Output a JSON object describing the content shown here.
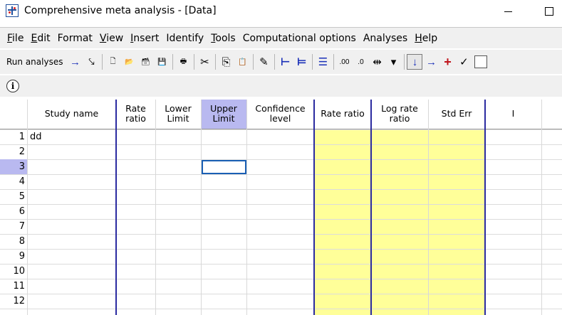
{
  "window": {
    "title": "Comprehensive meta analysis - [Data]"
  },
  "menu": [
    {
      "label": "File",
      "ul": "F",
      "rest": "ile"
    },
    {
      "label": "Edit",
      "ul": "E",
      "rest": "dit"
    },
    {
      "label": "Format",
      "ul": "",
      "rest": "Format"
    },
    {
      "label": "View",
      "ul": "V",
      "rest": "iew"
    },
    {
      "label": "Insert",
      "ul": "I",
      "rest": "nsert"
    },
    {
      "label": "Identify",
      "ul": "",
      "rest": "Identify"
    },
    {
      "label": "Tools",
      "ul": "T",
      "rest": "ools"
    },
    {
      "label": "Computational options",
      "ul": "",
      "rest": "Computational options"
    },
    {
      "label": "Analyses",
      "ul": "",
      "rest": "Analyses"
    },
    {
      "label": "Help",
      "ul": "H",
      "rest": "elp"
    }
  ],
  "toolbar": {
    "run_label": "Run analyses",
    "icons": [
      {
        "name": "run-arrow-icon",
        "glyph": "→"
      },
      {
        "name": "wand-icon",
        "glyph": "⤥"
      },
      {
        "name": "new-file-icon",
        "glyph": "🗋"
      },
      {
        "name": "open-folder-icon",
        "glyph": "📂"
      },
      {
        "name": "save-all-icon",
        "glyph": "🗃"
      },
      {
        "name": "save-icon",
        "glyph": "💾"
      },
      {
        "name": "print-icon",
        "glyph": "🖶"
      },
      {
        "name": "cut-icon",
        "glyph": "✂"
      },
      {
        "name": "copy-icon",
        "glyph": "⎘"
      },
      {
        "name": "paste-icon",
        "glyph": "📋"
      },
      {
        "name": "edit-icon",
        "glyph": "✎"
      },
      {
        "name": "decrease-indent-icon",
        "glyph": "⊢"
      },
      {
        "name": "increase-indent-icon",
        "glyph": "⊨"
      },
      {
        "name": "list-indent-icon",
        "glyph": "☰"
      },
      {
        "name": "increase-decimals-icon",
        "glyph": ".00"
      },
      {
        "name": "decrease-decimals-icon",
        "glyph": ".0"
      },
      {
        "name": "column-width-icon",
        "glyph": "⇹"
      },
      {
        "name": "dropdown-icon",
        "glyph": "▾"
      },
      {
        "name": "move-down-icon",
        "glyph": "↓"
      },
      {
        "name": "move-right-icon",
        "glyph": "→"
      },
      {
        "name": "plus-icon",
        "glyph": "+"
      },
      {
        "name": "check-icon",
        "glyph": "✓"
      }
    ]
  },
  "grid": {
    "headers": [
      {
        "label": "Study name"
      },
      {
        "label": "Rate\nratio"
      },
      {
        "label": "Lower\nLimit"
      },
      {
        "label": "Upper\nLimit"
      },
      {
        "label": "Confidence\nlevel"
      },
      {
        "label": "Rate ratio"
      },
      {
        "label": "Log rate\nratio"
      },
      {
        "label": "Std Err"
      },
      {
        "label": "I"
      }
    ],
    "rows": [
      {
        "num": "1",
        "study": "dd"
      },
      {
        "num": "2",
        "study": ""
      },
      {
        "num": "3",
        "study": ""
      },
      {
        "num": "4",
        "study": ""
      },
      {
        "num": "5",
        "study": ""
      },
      {
        "num": "6",
        "study": ""
      },
      {
        "num": "7",
        "study": ""
      },
      {
        "num": "8",
        "study": ""
      },
      {
        "num": "9",
        "study": ""
      },
      {
        "num": "10",
        "study": ""
      },
      {
        "num": "11",
        "study": ""
      },
      {
        "num": "12",
        "study": ""
      }
    ],
    "selected_row": "3",
    "selected_column": "Upper\nLimit"
  },
  "colors": {
    "computed_columns": "#ffff99",
    "selection": "#b9b9f0",
    "separator": "#2b2ba0"
  }
}
